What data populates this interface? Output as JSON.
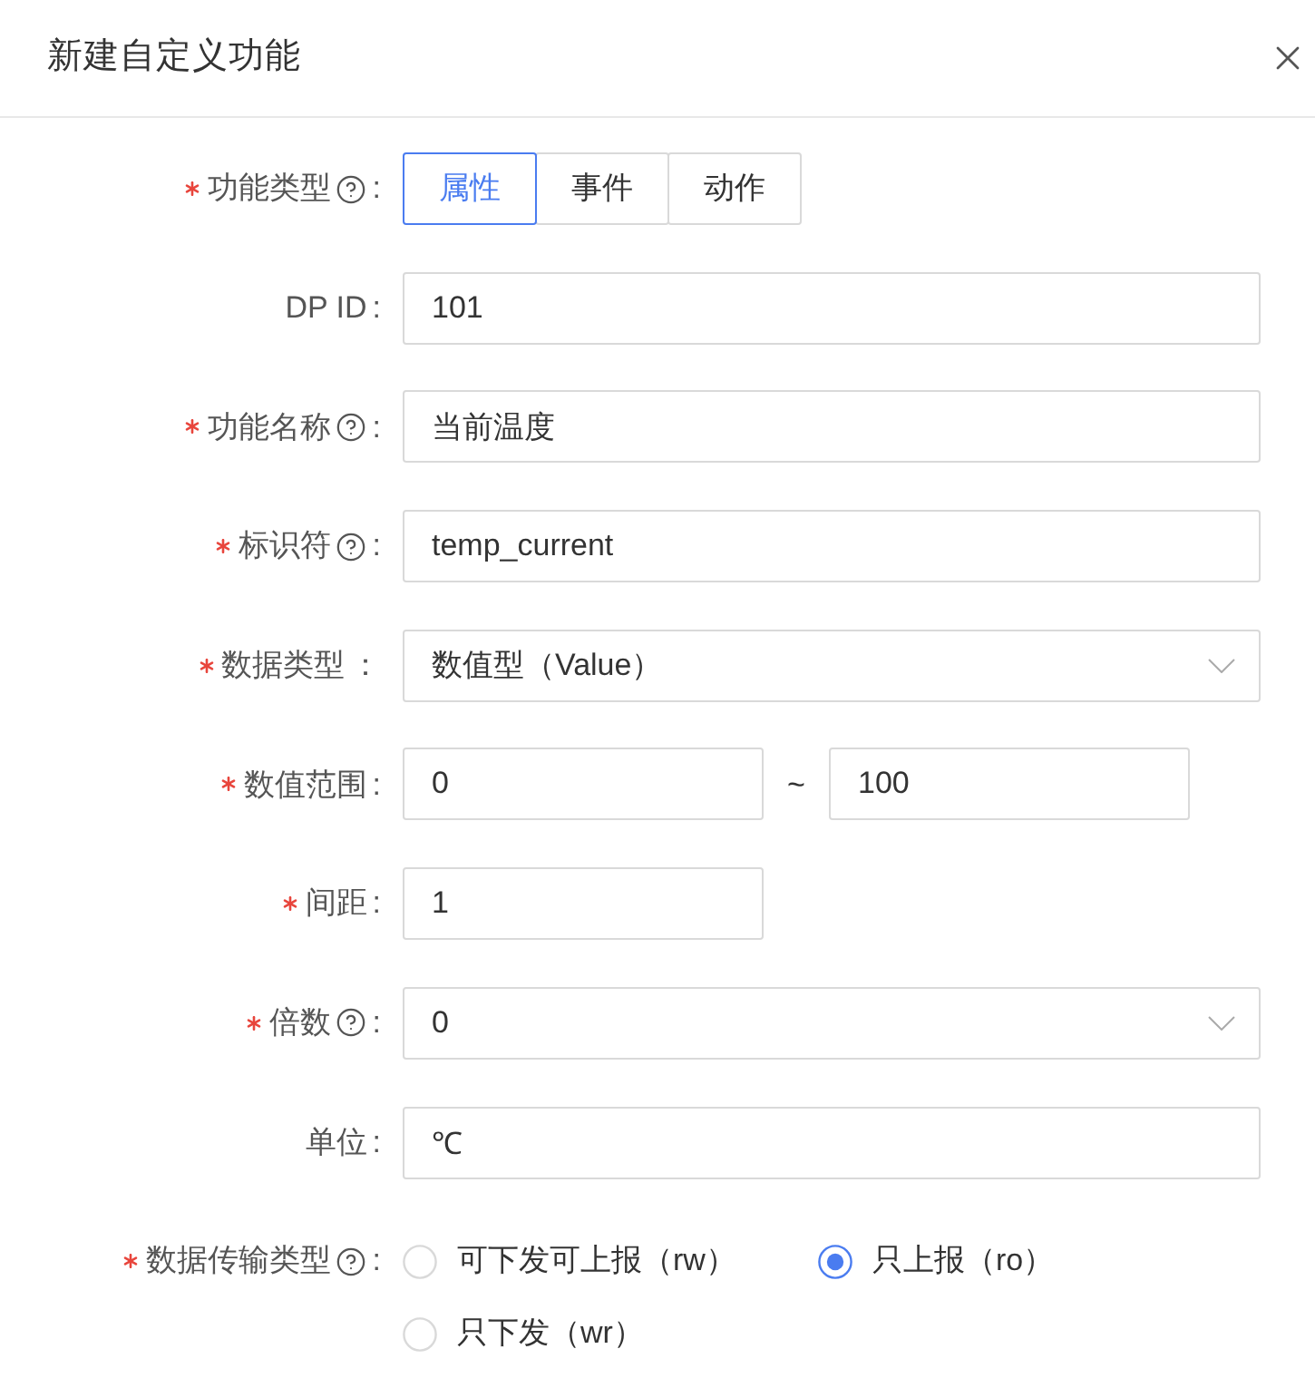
{
  "dialog": {
    "title": "新建自定义功能"
  },
  "fields": [
    {
      "kind": "segmented",
      "label": "功能类型",
      "required": true,
      "help": true,
      "colon": ":",
      "options": [
        {
          "label": "属性",
          "selected": true
        },
        {
          "label": "事件",
          "selected": false
        },
        {
          "label": "动作",
          "selected": false
        }
      ]
    },
    {
      "kind": "input",
      "label": "DP ID",
      "required": false,
      "help": false,
      "colon": ":",
      "value": "101"
    },
    {
      "kind": "input",
      "label": "功能名称",
      "required": true,
      "help": true,
      "colon": ":",
      "value": "当前温度"
    },
    {
      "kind": "input",
      "label": "标识符",
      "required": true,
      "help": true,
      "colon": ":",
      "value": "temp_current"
    },
    {
      "kind": "select",
      "label": "数据类型",
      "required": true,
      "help": false,
      "colon": "：",
      "value": "数值型（Value）"
    },
    {
      "kind": "range",
      "label": "数值范围",
      "required": true,
      "help": false,
      "colon": ":",
      "min": "0",
      "separator": "~",
      "max": "100"
    },
    {
      "kind": "short_input",
      "label": "间距",
      "required": true,
      "help": false,
      "colon": ":",
      "value": "1"
    },
    {
      "kind": "select",
      "label": "倍数",
      "required": true,
      "help": true,
      "colon": ":",
      "value": "0"
    },
    {
      "kind": "input",
      "label": "单位",
      "required": false,
      "help": false,
      "colon": ":",
      "value": "℃"
    },
    {
      "kind": "radio",
      "label": "数据传输类型",
      "required": true,
      "help": true,
      "colon": ":",
      "options": [
        {
          "label": "可下发可上报（rw）",
          "selected": false
        },
        {
          "label": "只上报（ro）",
          "selected": true
        },
        {
          "label": "只下发（wr）",
          "selected": false
        }
      ]
    }
  ]
}
